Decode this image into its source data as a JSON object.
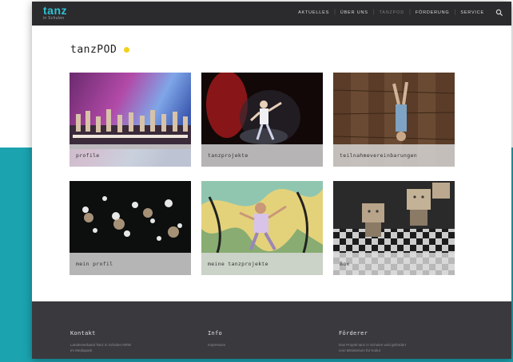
{
  "brand": {
    "logo_main": "tanz",
    "logo_sub": "in Schulen"
  },
  "nav": {
    "items": [
      {
        "label": "Aktuelles",
        "active": false
      },
      {
        "label": "Über uns",
        "active": false
      },
      {
        "label": "tanzPOD",
        "active": true
      },
      {
        "label": "Förderung",
        "active": false
      },
      {
        "label": "Service",
        "active": false
      }
    ],
    "search_icon": "search-icon"
  },
  "page": {
    "title": "tanzPOD",
    "accent_color": "#f2d11c"
  },
  "tiles": [
    {
      "label": "profile"
    },
    {
      "label": "tanzprojekte"
    },
    {
      "label": "teilnahmevereinbarungen"
    },
    {
      "label": "mein profil"
    },
    {
      "label": "meine tanzprojekte"
    },
    {
      "label": "Box"
    }
  ],
  "footer": {
    "columns": [
      {
        "heading": "Kontakt",
        "line1": "Landesverband Tanz in Schulen NRW",
        "line2": "Im Mediapark"
      },
      {
        "heading": "Info",
        "line1": "Impressum",
        "line2": ""
      },
      {
        "heading": "Förderer",
        "line1": "Das Projekt tanz in Schulen wird gefördert",
        "line2": "vom Ministerium für Kultur"
      }
    ]
  },
  "colors": {
    "teal": "#1ba3b0",
    "topbar": "#2b2b2e",
    "footer": "#3a3a3e",
    "logo": "#2ec2d3"
  }
}
